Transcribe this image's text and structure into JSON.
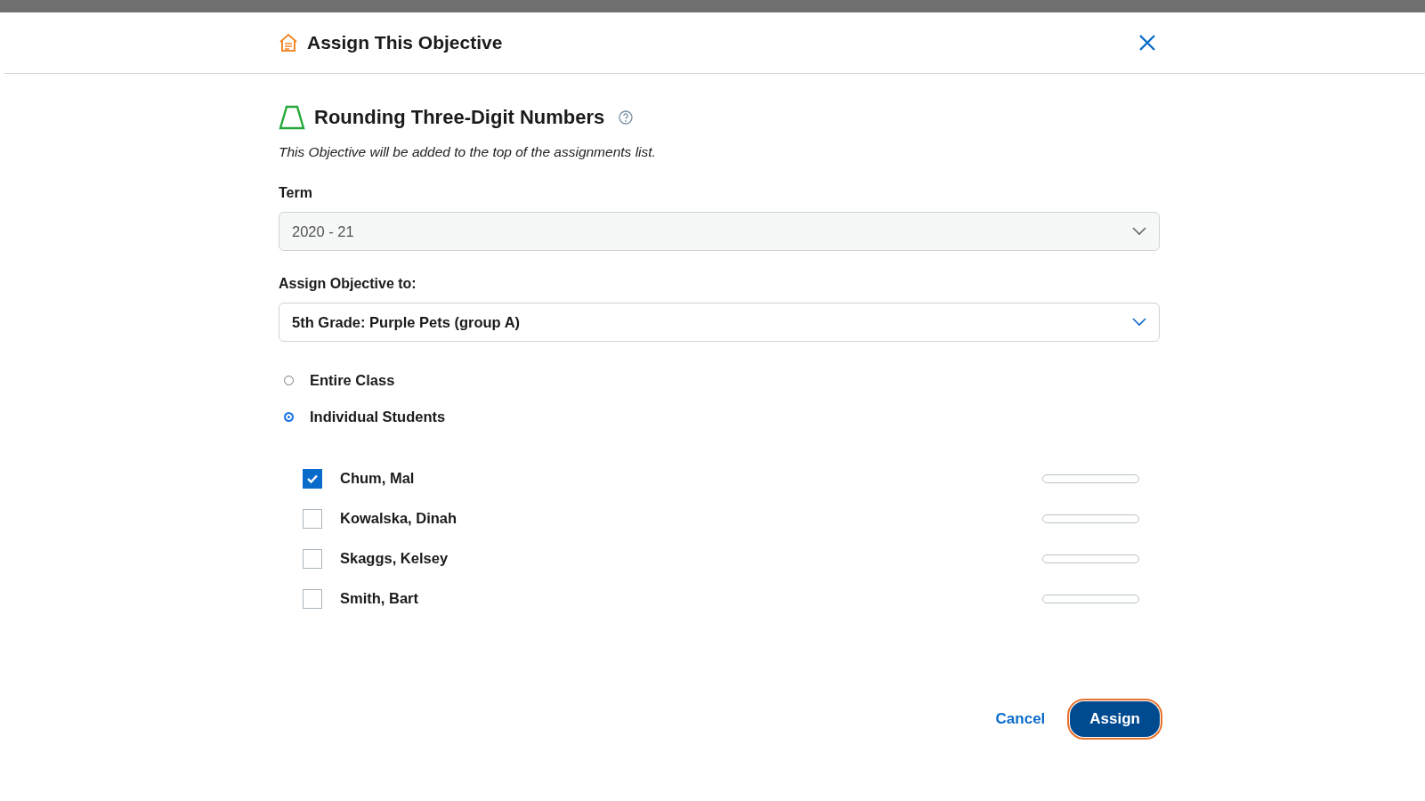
{
  "dialog": {
    "title": "Assign This Objective"
  },
  "objective": {
    "title": "Rounding Three-Digit Numbers",
    "note": "This Objective will be added to the top of the assignments list."
  },
  "term": {
    "label": "Term",
    "value": "2020 - 21",
    "disabled": true
  },
  "assign_to": {
    "label": "Assign Objective to:",
    "value": "5th Grade: Purple Pets (group A)",
    "disabled": false
  },
  "scope": [
    {
      "label": "Entire Class",
      "selected": false
    },
    {
      "label": "Individual Students",
      "selected": true
    }
  ],
  "students": [
    {
      "name": "Chum, Mal",
      "checked": true,
      "level": 0
    },
    {
      "name": "Kowalska, Dinah",
      "checked": false,
      "level": 0
    },
    {
      "name": "Skaggs, Kelsey",
      "checked": false,
      "level": 0
    },
    {
      "name": "Smith, Bart",
      "checked": false,
      "level": 0
    }
  ],
  "buttons": {
    "cancel": "Cancel",
    "assign": "Assign",
    "assign_focused": true
  }
}
